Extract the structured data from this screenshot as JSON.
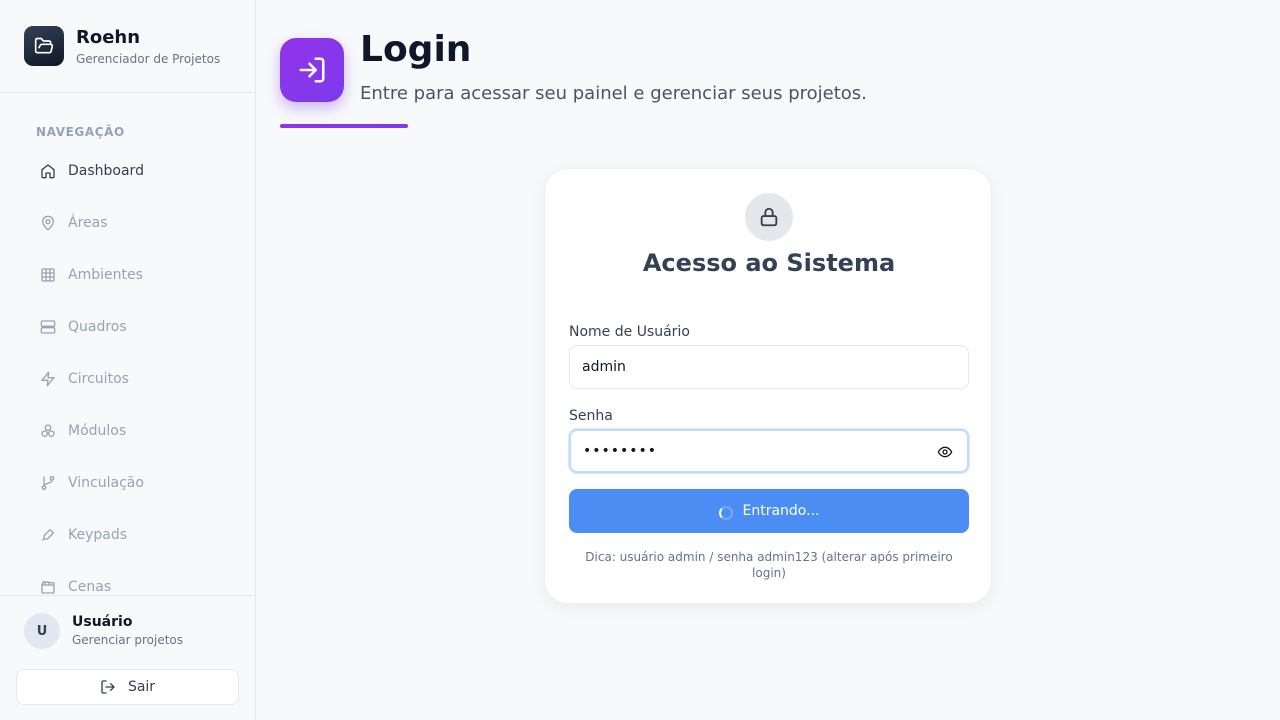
{
  "brand": {
    "name": "Roehn",
    "subtitle": "Gerenciador de Projetos"
  },
  "sidebar": {
    "section_title": "NAVEGAÇÃO",
    "items": [
      {
        "label": "Dashboard",
        "icon": "home-icon",
        "active": true
      },
      {
        "label": "Áreas",
        "icon": "map-pin-icon"
      },
      {
        "label": "Ambientes",
        "icon": "grid-icon"
      },
      {
        "label": "Quadros",
        "icon": "server-icon"
      },
      {
        "label": "Circuitos",
        "icon": "zap-icon"
      },
      {
        "label": "Módulos",
        "icon": "modules-icon"
      },
      {
        "label": "Vinculação",
        "icon": "git-branch-icon"
      },
      {
        "label": "Keypads",
        "icon": "keypad-icon"
      },
      {
        "label": "Cenas",
        "icon": "clapperboard-icon"
      }
    ]
  },
  "user": {
    "initial": "U",
    "name": "Usuário",
    "subtitle": "Gerenciar projetos",
    "logout_label": "Sair"
  },
  "header": {
    "title": "Login",
    "subtitle": "Entre para acessar seu painel e gerenciar seus projetos."
  },
  "form": {
    "title": "Acesso ao Sistema",
    "username_label": "Nome de Usuário",
    "username_value": "admin",
    "password_label": "Senha",
    "password_masked": "••••••••",
    "submit_label": "Entrando...",
    "hint": "Dica: usuário admin / senha admin123 (alterar após primeiro login)"
  },
  "colors": {
    "accent": "#7c3aed",
    "primary_button": "#4b8df2",
    "sidebar_bg": "#f8f9fb"
  }
}
